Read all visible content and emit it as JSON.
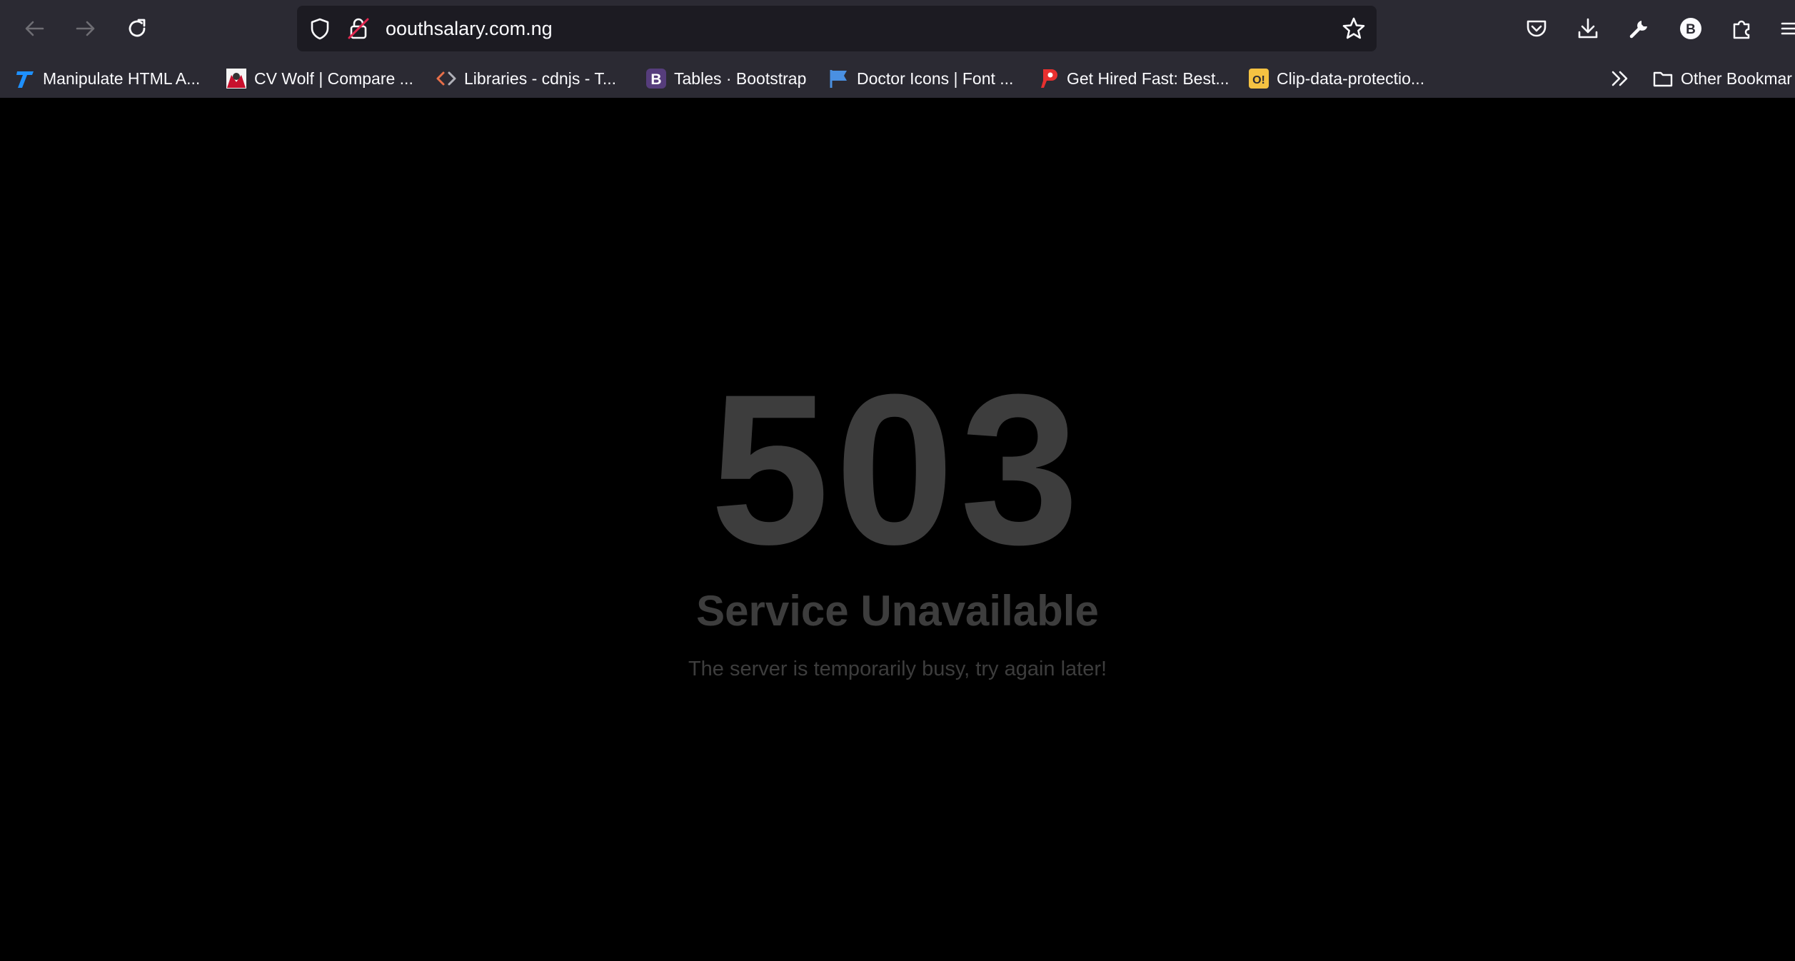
{
  "browser": {
    "url": "oouthsalary.com.ng",
    "profile_initial": "B",
    "bookmarks": [
      {
        "label": "Manipulate HTML A...",
        "icon": "t-logo-icon"
      },
      {
        "label": "CV Wolf | Compare ...",
        "icon": "cvwolf-icon"
      },
      {
        "label": "Libraries - cdnjs - T...",
        "icon": "code-brackets-icon"
      },
      {
        "label": "Tables · Bootstrap",
        "icon": "bootstrap-icon"
      },
      {
        "label": "Doctor Icons | Font ...",
        "icon": "flag-icon"
      },
      {
        "label": "Get Hired Fast: Best...",
        "icon": "p-logo-icon"
      },
      {
        "label": "Clip-data-protectio...",
        "icon": "o-logo-icon"
      }
    ],
    "other_bookmarks": "Other Bookmar",
    "bootstrap_letter": "B",
    "o_logo_letter": "O!"
  },
  "page": {
    "code": "503",
    "title": "Service Unavailable",
    "message": "The server is temporarily busy, try again later!"
  },
  "colors": {
    "chrome_bg": "#2b2a33",
    "urlbar_bg": "#1c1b22",
    "page_bg": "#000000",
    "error_text": "#3d3d3d"
  }
}
